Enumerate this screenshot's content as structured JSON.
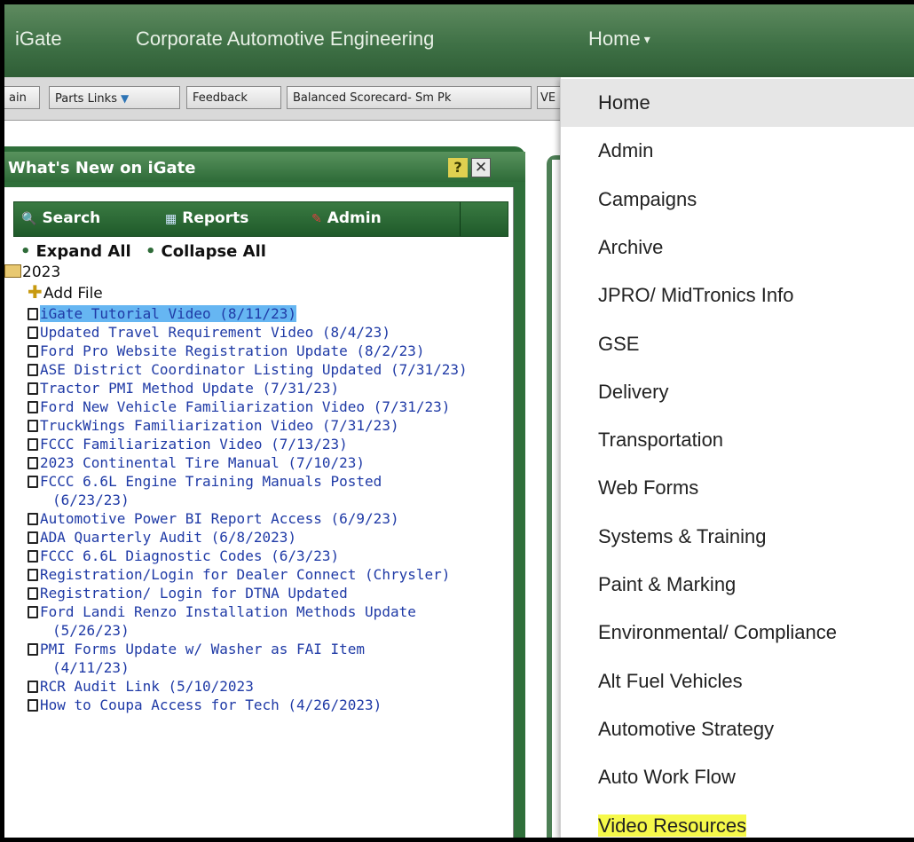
{
  "topnav": {
    "brand": "iGate",
    "org": "Corporate Automotive Engineering",
    "home": "Home",
    "caret": "▾"
  },
  "linkbar": {
    "items": [
      "ain",
      "Parts Links",
      "Feedback",
      "Balanced Scorecard- Sm Pk",
      "VE"
    ]
  },
  "panel": {
    "title": "What's New on iGate",
    "help": "?",
    "close": "✕",
    "toolbar": {
      "search": "Search",
      "reports": "Reports",
      "admin": "Admin"
    },
    "expand_all": "Expand All",
    "collapse_all": "Collapse All",
    "folder": "2023",
    "add_file": "Add File",
    "items": [
      {
        "text": "iGate Tutorial Video (8/11/23)",
        "highlight": true
      },
      {
        "text": "Updated Travel Requirement Video (8/4/23)"
      },
      {
        "text": "Ford Pro Website Registration Update (8/2/23)"
      },
      {
        "text": "ASE District Coordinator Listing Updated (7/31/23)"
      },
      {
        "text": "Tractor PMI Method Update (7/31/23)"
      },
      {
        "text": "Ford New Vehicle Familiarization Video (7/31/23)"
      },
      {
        "text": "TruckWings Familiarization Video (7/31/23)"
      },
      {
        "text": "FCCC Familiarization Video (7/13/23)"
      },
      {
        "text": "2023 Continental Tire Manual (7/10/23)"
      },
      {
        "text": "FCCC 6.6L Engine Training Manuals Posted",
        "cont": "(6/23/23)"
      },
      {
        "text": "Automotive Power BI Report Access (6/9/23)"
      },
      {
        "text": "ADA Quarterly Audit (6/8/2023)"
      },
      {
        "text": "FCCC 6.6L Diagnostic Codes (6/3/23)"
      },
      {
        "text": "Registration/Login for Dealer Connect (Chrysler)"
      },
      {
        "text": "Registration/ Login for DTNA Updated"
      },
      {
        "text": "Ford Landi Renzo Installation Methods Update",
        "cont": "(5/26/23)"
      },
      {
        "text": "PMI Forms Update w/ Washer as FAI Item",
        "cont": "(4/11/23)"
      },
      {
        "text": "RCR Audit Link (5/10/2023"
      },
      {
        "text": "How to Coupa Access for Tech (4/26/2023)"
      }
    ]
  },
  "menu": {
    "items": [
      "Home",
      "Admin",
      "Campaigns",
      "Archive",
      "JPRO/ MidTronics Info",
      "GSE",
      "Delivery",
      "Transportation",
      "Web Forms",
      "Systems & Training",
      "Paint & Marking",
      "Environmental/ Compliance",
      "Alt Fuel Vehicles",
      "Automotive Strategy",
      "Auto Work Flow",
      "Video Resources"
    ],
    "active_index": 0,
    "highlight_index": 15
  }
}
